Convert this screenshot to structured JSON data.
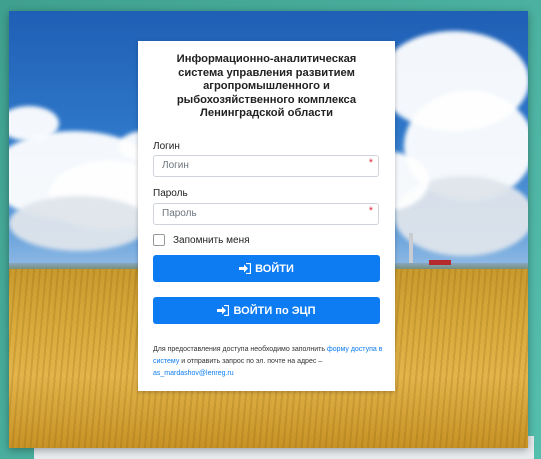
{
  "login_form": {
    "title": "Информационно-аналитическая система управления развитием агропромышленного и рыбохозяйственного комплекса Ленинградской области",
    "login_label": "Логин",
    "login_placeholder": "Логин",
    "password_label": "Пароль",
    "password_placeholder": "Пароль",
    "required_mark": "*",
    "remember_label": "Запомнить меня",
    "login_button": "ВОЙТИ",
    "ecp_button": "ВОЙТИ по ЭЦП",
    "note_part1": "Для предоставления доступа необходимо заполнить ",
    "note_link": "форму доступа в систему",
    "note_part2": " и отправить запрос по эл. почте на адрес – ",
    "note_email": "as_mardashov@lenreg.ru"
  },
  "icons": {
    "login": "sign-in-icon",
    "ecp": "sign-in-icon"
  },
  "colors": {
    "primary": "#0d7cf2",
    "required": "#dc3545",
    "background_frame": "#4aa89a"
  }
}
